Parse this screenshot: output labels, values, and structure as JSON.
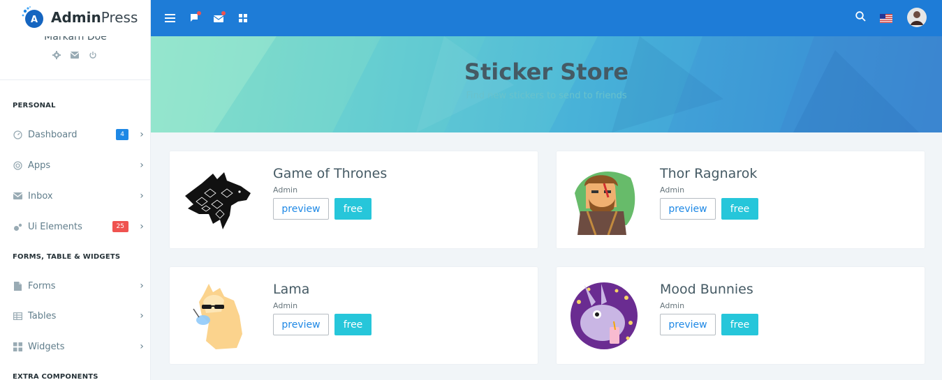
{
  "app": {
    "logo_bold": "Admin",
    "logo_light": "Press",
    "logo_letter": "A"
  },
  "profile": {
    "name": "Markarn Doe"
  },
  "sidebar": {
    "captions": [
      "PERSONAL",
      "FORMS, TABLE & WIDGETS",
      "EXTRA COMPONENTS"
    ],
    "items": [
      {
        "label": "Dashboard",
        "badge": "4",
        "badge_color": "#1e88e5",
        "icon": "dashboard-gauge-icon"
      },
      {
        "label": "Apps",
        "badge": "",
        "icon": "target-icon"
      },
      {
        "label": "Inbox",
        "badge": "",
        "icon": "envelope-icon"
      },
      {
        "label": "Ui Elements",
        "badge": "25",
        "badge_color": "#ef5350",
        "icon": "bubbles-icon"
      },
      {
        "label": "Forms",
        "badge": "",
        "icon": "file-icon"
      },
      {
        "label": "Tables",
        "badge": "",
        "icon": "table-icon"
      },
      {
        "label": "Widgets",
        "badge": "",
        "icon": "widgets-icon"
      }
    ]
  },
  "topbar": {
    "icons": [
      "hamburger-menu-icon",
      "chat-flag-icon",
      "mail-icon",
      "grid-apps-icon",
      "search-icon",
      "us-flag-icon",
      "user-avatar"
    ],
    "bg_color": "#1e7cd7"
  },
  "banner": {
    "title": "Sticker Store",
    "subtitle": "Find new stickers to send to friends"
  },
  "cards": [
    {
      "title": "Game of Thrones",
      "author": "Admin",
      "preview_label": "preview",
      "price_label": "free",
      "sticker": "direwolf-sticker"
    },
    {
      "title": "Thor Ragnarok",
      "author": "Admin",
      "preview_label": "preview",
      "price_label": "free",
      "sticker": "thor-sticker"
    },
    {
      "title": "Lama",
      "author": "Admin",
      "preview_label": "preview",
      "price_label": "free",
      "sticker": "llama-sticker"
    },
    {
      "title": "Mood Bunnies",
      "author": "Admin",
      "preview_label": "preview",
      "price_label": "free",
      "sticker": "bunny-sticker"
    }
  ],
  "colors": {
    "accent": "#1e88e5",
    "free_button": "#26c6da",
    "danger": "#ef5350"
  }
}
